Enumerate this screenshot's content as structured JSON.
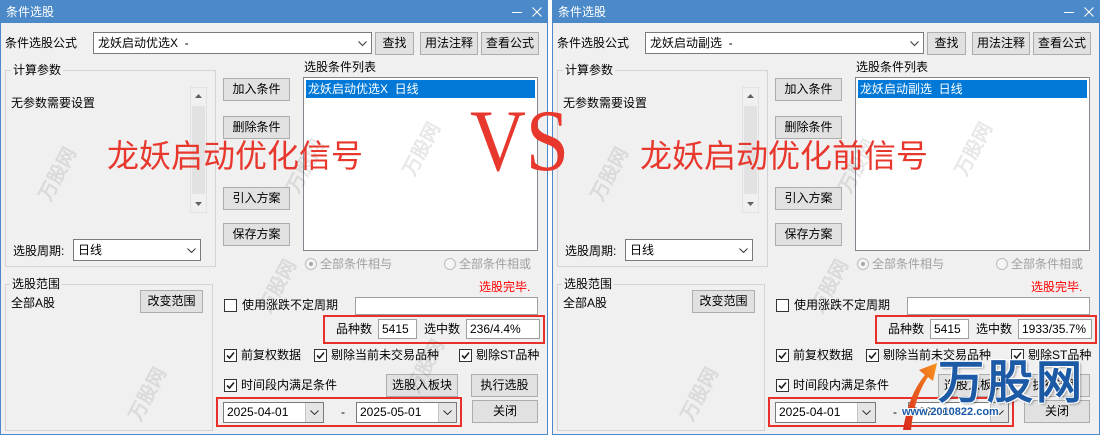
{
  "windows": [
    {
      "title": "条件选股",
      "formula_label": "条件选股公式",
      "formula_value": "龙妖启动优选X  -",
      "buttons": {
        "find": "查找",
        "usage": "用法注释",
        "view": "查看公式",
        "add": "加入条件",
        "delete": "删除条件",
        "import": "引入方案",
        "save": "保存方案",
        "change_range": "改变范围",
        "to_block": "选股入板块",
        "execute": "执行选股",
        "close": "关闭"
      },
      "params_group": "计算参数",
      "params_text": "无参数需要设置",
      "period_label": "选股周期:",
      "period_value": "日线",
      "list_label": "选股条件列表",
      "list_items": [
        "龙妖启动优选X  日线"
      ],
      "logic": {
        "and_label": "全部条件相与",
        "and_selected": true,
        "or_label": "全部条件相或",
        "or_selected": false
      },
      "status": "选股完毕.",
      "range_group": "选股范围",
      "range_value": "全部A股",
      "uncertain_period": {
        "label": "使用涨跌不定周期",
        "checked": false,
        "value": ""
      },
      "stats": {
        "count_label": "品种数",
        "count_value": "5415",
        "selected_label": "选中数",
        "selected_value": "236/4.4%"
      },
      "options": [
        {
          "label": "前复权数据",
          "checked": true
        },
        {
          "label": "剔除当前未交易品种",
          "checked": true
        },
        {
          "label": "剔除ST品种",
          "checked": true
        }
      ],
      "timespan": {
        "label": "时间段内满足条件",
        "checked": true
      },
      "date_from": "2025-04-01",
      "date_sep": "-",
      "date_to": "2025-05-01"
    },
    {
      "title": "条件选股",
      "formula_label": "条件选股公式",
      "formula_value": "龙妖启动副选  -",
      "buttons": {
        "find": "查找",
        "usage": "用法注释",
        "view": "查看公式",
        "add": "加入条件",
        "delete": "删除条件",
        "import": "引入方案",
        "save": "保存方案",
        "change_range": "改变范围",
        "to_block": "选股入板块",
        "execute": "执行选股",
        "close": "关闭"
      },
      "params_group": "计算参数",
      "params_text": "无参数需要设置",
      "period_label": "选股周期:",
      "period_value": "日线",
      "list_label": "选股条件列表",
      "list_items": [
        "龙妖启动副选  日线"
      ],
      "logic": {
        "and_label": "全部条件相与",
        "and_selected": true,
        "or_label": "全部条件相或",
        "or_selected": false
      },
      "status": "选股完毕.",
      "range_group": "选股范围",
      "range_value": "全部A股",
      "uncertain_period": {
        "label": "使用涨跌不定周期",
        "checked": false,
        "value": ""
      },
      "stats": {
        "count_label": "品种数",
        "count_value": "5415",
        "selected_label": "选中数",
        "selected_value": "1933/35.7%"
      },
      "options": [
        {
          "label": "前复权数据",
          "checked": true
        },
        {
          "label": "剔除当前未交易品种",
          "checked": true
        },
        {
          "label": "剔除ST品种",
          "checked": true
        }
      ],
      "timespan": {
        "label": "时间段内满足条件",
        "checked": true
      },
      "date_from": "2025-04-01",
      "date_sep": "-",
      "date_to": "2025-05-01"
    }
  ],
  "overlay": {
    "left_caption": "龙妖启动优化信号",
    "vs": "VS",
    "right_caption": "龙妖启动优化前信号"
  },
  "watermark": {
    "logo_text": "万股网",
    "url": "www.2010822.com"
  },
  "colors": {
    "title-bar": "#4b89c9",
    "highlight": "#e8302a",
    "caption": "#e8382e",
    "status": "#ff0000",
    "selection": "#0078d7",
    "logo-blue": "#1d5aa6",
    "logo-orange": "#f26522"
  }
}
